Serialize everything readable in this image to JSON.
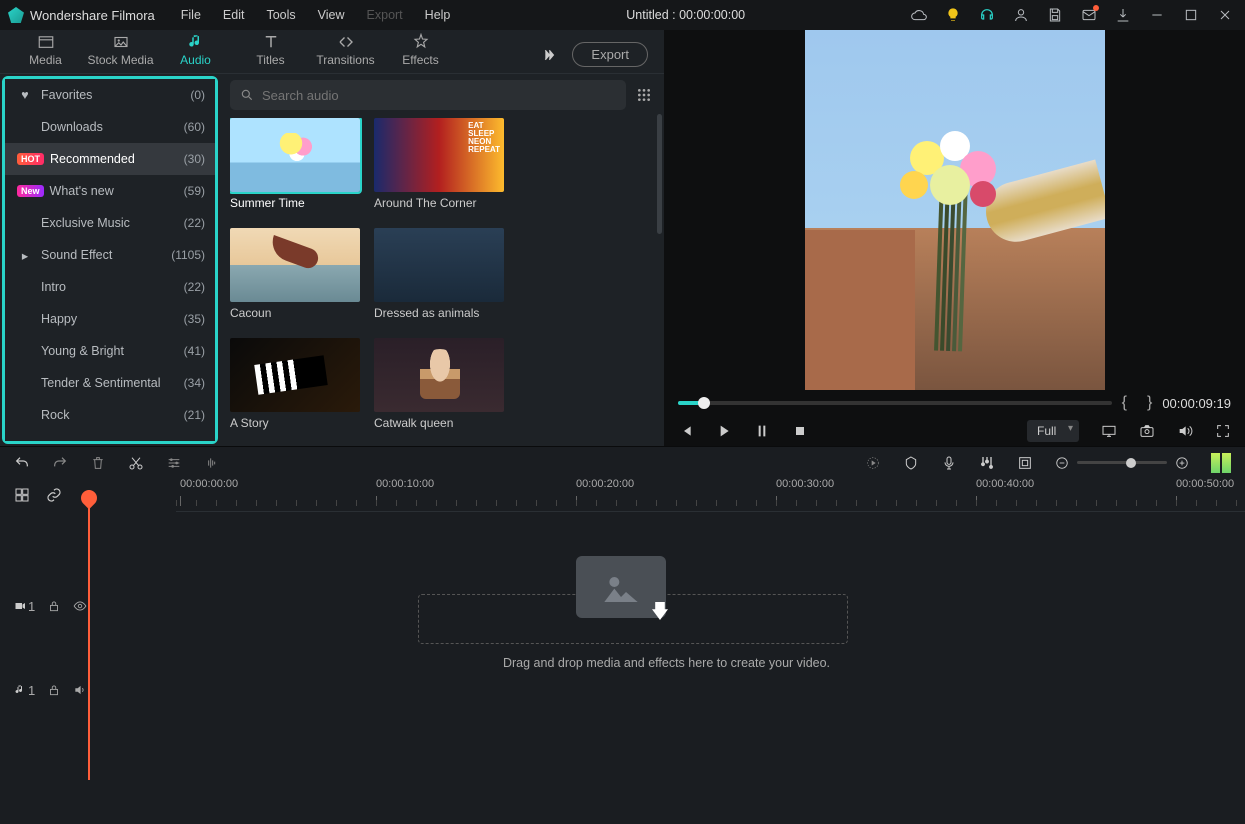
{
  "app": {
    "name": "Wondershare Filmora"
  },
  "menu": [
    "File",
    "Edit",
    "Tools",
    "View",
    "Export",
    "Help"
  ],
  "menu_disabled_index": 4,
  "title": "Untitled : 00:00:00:00",
  "tabs": [
    {
      "id": "media",
      "label": "Media"
    },
    {
      "id": "stock",
      "label": "Stock Media"
    },
    {
      "id": "audio",
      "label": "Audio"
    },
    {
      "id": "titles",
      "label": "Titles"
    },
    {
      "id": "transitions",
      "label": "Transitions"
    },
    {
      "id": "effects",
      "label": "Effects"
    }
  ],
  "active_tab": "audio",
  "export_label": "Export",
  "sidebar": [
    {
      "label": "Favorites",
      "count": "(0)",
      "icon": "heart"
    },
    {
      "label": "Downloads",
      "count": "(60)"
    },
    {
      "label": "Recommended",
      "count": "(30)",
      "badge": "HOT",
      "active": true
    },
    {
      "label": "What's new",
      "count": "(59)",
      "badge": "New"
    },
    {
      "label": "Exclusive Music",
      "count": "(22)"
    },
    {
      "label": "Sound Effect",
      "count": "(1105)",
      "icon": "caret"
    },
    {
      "label": "Intro",
      "count": "(22)"
    },
    {
      "label": "Happy",
      "count": "(35)"
    },
    {
      "label": "Young & Bright",
      "count": "(41)"
    },
    {
      "label": "Tender & Sentimental",
      "count": "(34)"
    },
    {
      "label": "Rock",
      "count": "(21)"
    }
  ],
  "search": {
    "placeholder": "Search audio"
  },
  "cards": [
    {
      "label": "Summer Time",
      "thumb": "t0",
      "selected": true
    },
    {
      "label": "Around The Corner",
      "thumb": "t1"
    },
    {
      "label": "Cacoun",
      "thumb": "t2"
    },
    {
      "label": "Dressed as animals",
      "thumb": "t3"
    },
    {
      "label": "A Story",
      "thumb": "t4"
    },
    {
      "label": "Catwalk queen",
      "thumb": "t5"
    }
  ],
  "preview": {
    "time": "00:00:09:19",
    "quality": "Full"
  },
  "ruler": {
    "start": "00:00:00:00",
    "marks": [
      "00:00:10:00",
      "00:00:20:00",
      "00:00:30:00",
      "00:00:40:00",
      "00:00:50:00"
    ]
  },
  "tracks": {
    "video": {
      "name": "1"
    },
    "audio": {
      "name": "1"
    },
    "hint": "Drag and drop media and effects here to create your video."
  }
}
